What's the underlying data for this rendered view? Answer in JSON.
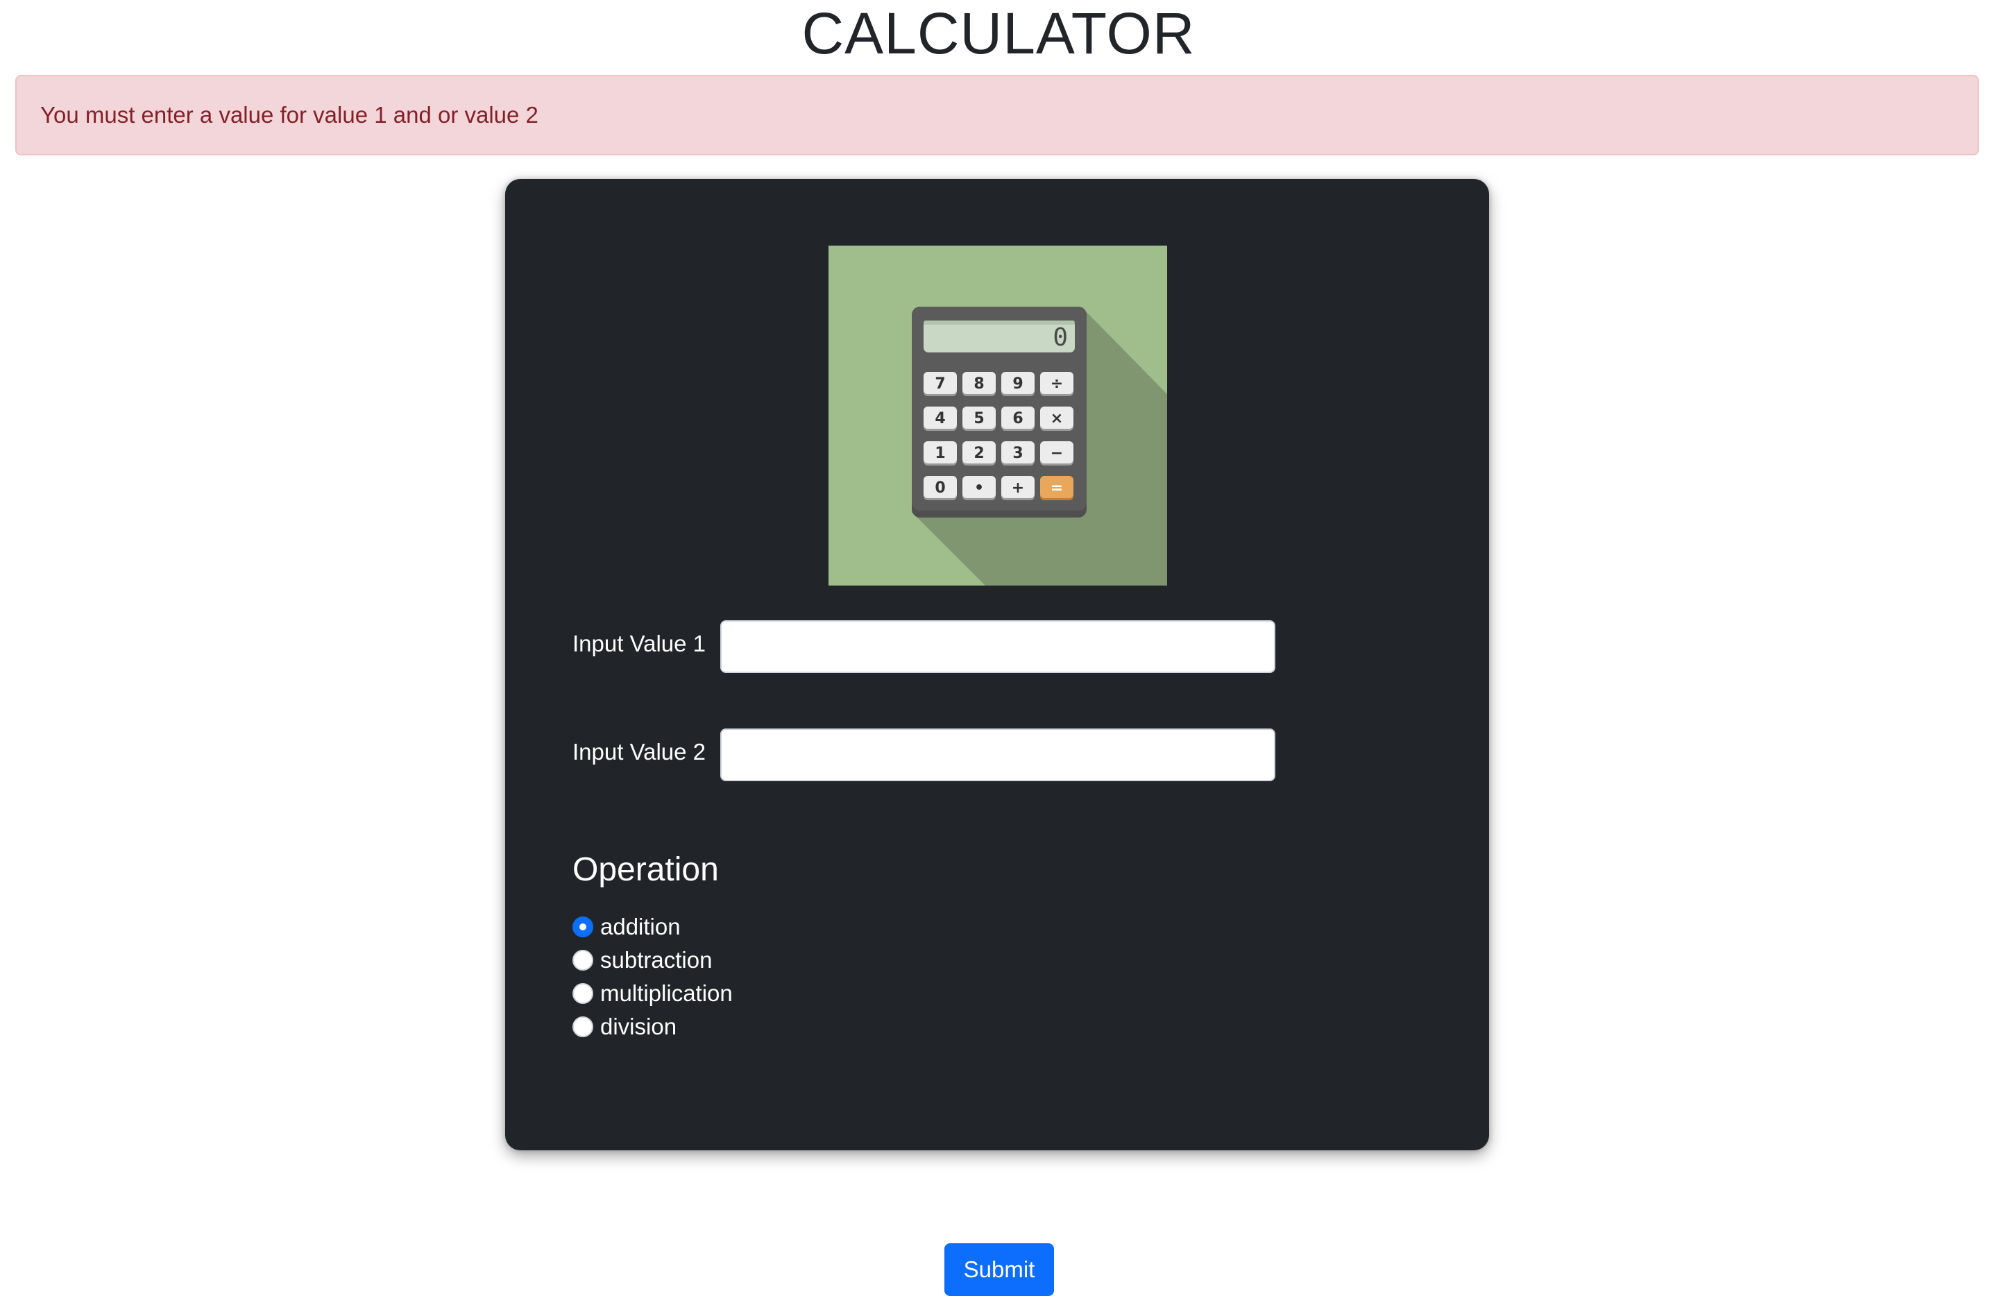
{
  "header": {
    "title": "CALCULATOR"
  },
  "alert": {
    "message": "You must enter a value for value 1 and or value 2"
  },
  "form": {
    "image_icon": "calculator-illustration",
    "input1": {
      "label": "Input Value 1",
      "value": "",
      "placeholder": ""
    },
    "input2": {
      "label": "Input Value 2",
      "value": "",
      "placeholder": ""
    },
    "operation": {
      "heading": "Operation",
      "selected": "addition",
      "options": [
        {
          "label": "addition",
          "checked": true
        },
        {
          "label": "subtraction",
          "checked": false
        },
        {
          "label": "multiplication",
          "checked": false
        },
        {
          "label": "division",
          "checked": false
        }
      ]
    },
    "submit_label": "Submit"
  },
  "calculator_image": {
    "display": "0",
    "keys": [
      "7",
      "8",
      "9",
      "÷",
      "4",
      "5",
      "6",
      "×",
      "1",
      "2",
      "3",
      "−",
      "0",
      "•",
      "+",
      "="
    ]
  },
  "colors": {
    "alert_bg": "#f3d6d9",
    "alert_text": "#842029",
    "card_bg": "#212529",
    "primary": "#0d6efd",
    "image_bg": "#a0be8c",
    "equals_key": "#e8a75a"
  }
}
